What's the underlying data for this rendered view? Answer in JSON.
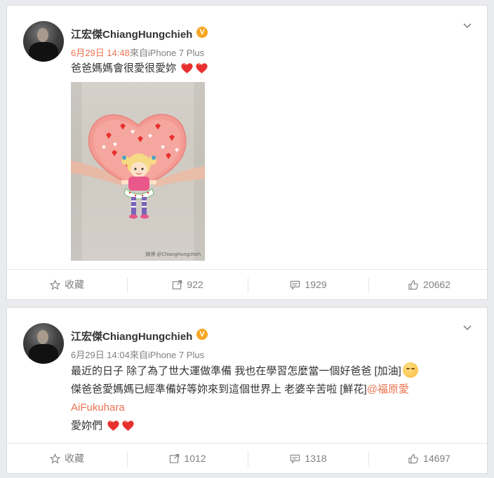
{
  "posts": [
    {
      "username": "江宏傑ChiangHungchieh",
      "time": "6月29日 14:48",
      "source": "來自iPhone 7 Plus",
      "text_line1": "爸爸媽媽會很愛很愛妳",
      "photo_watermark": "微博 @ChiangHungchieh",
      "actions": {
        "favorite": "收藏",
        "repost": "922",
        "comment": "1929",
        "like": "20662"
      }
    },
    {
      "username": "江宏傑ChiangHungchieh",
      "time": "6月29日 14:04",
      "source": "來自iPhone 7 Plus",
      "text_line1": "最近的日子 除了為了世大運做準備 我也在學習怎麼當一個好爸爸 [加油]",
      "text_line2": "傑爸爸愛媽媽已經準備好等妳來到這個世界上  老婆辛苦啦 [鮮花]",
      "mention": "@福原愛",
      "mention_cont": "AiFukuhara",
      "text_line4": "愛妳們",
      "actions": {
        "favorite": "收藏",
        "repost": "1012",
        "comment": "1318",
        "like": "14697"
      }
    }
  ],
  "colors": {
    "accent": "#eb7350",
    "verified": "#f6a623",
    "heart": "#e8312f"
  },
  "icons": [
    "chevron-down-icon",
    "verified-icon",
    "heart-icon",
    "star-icon",
    "repost-icon",
    "comment-icon",
    "thumbs-up-icon",
    "cheer-emoji-icon"
  ]
}
